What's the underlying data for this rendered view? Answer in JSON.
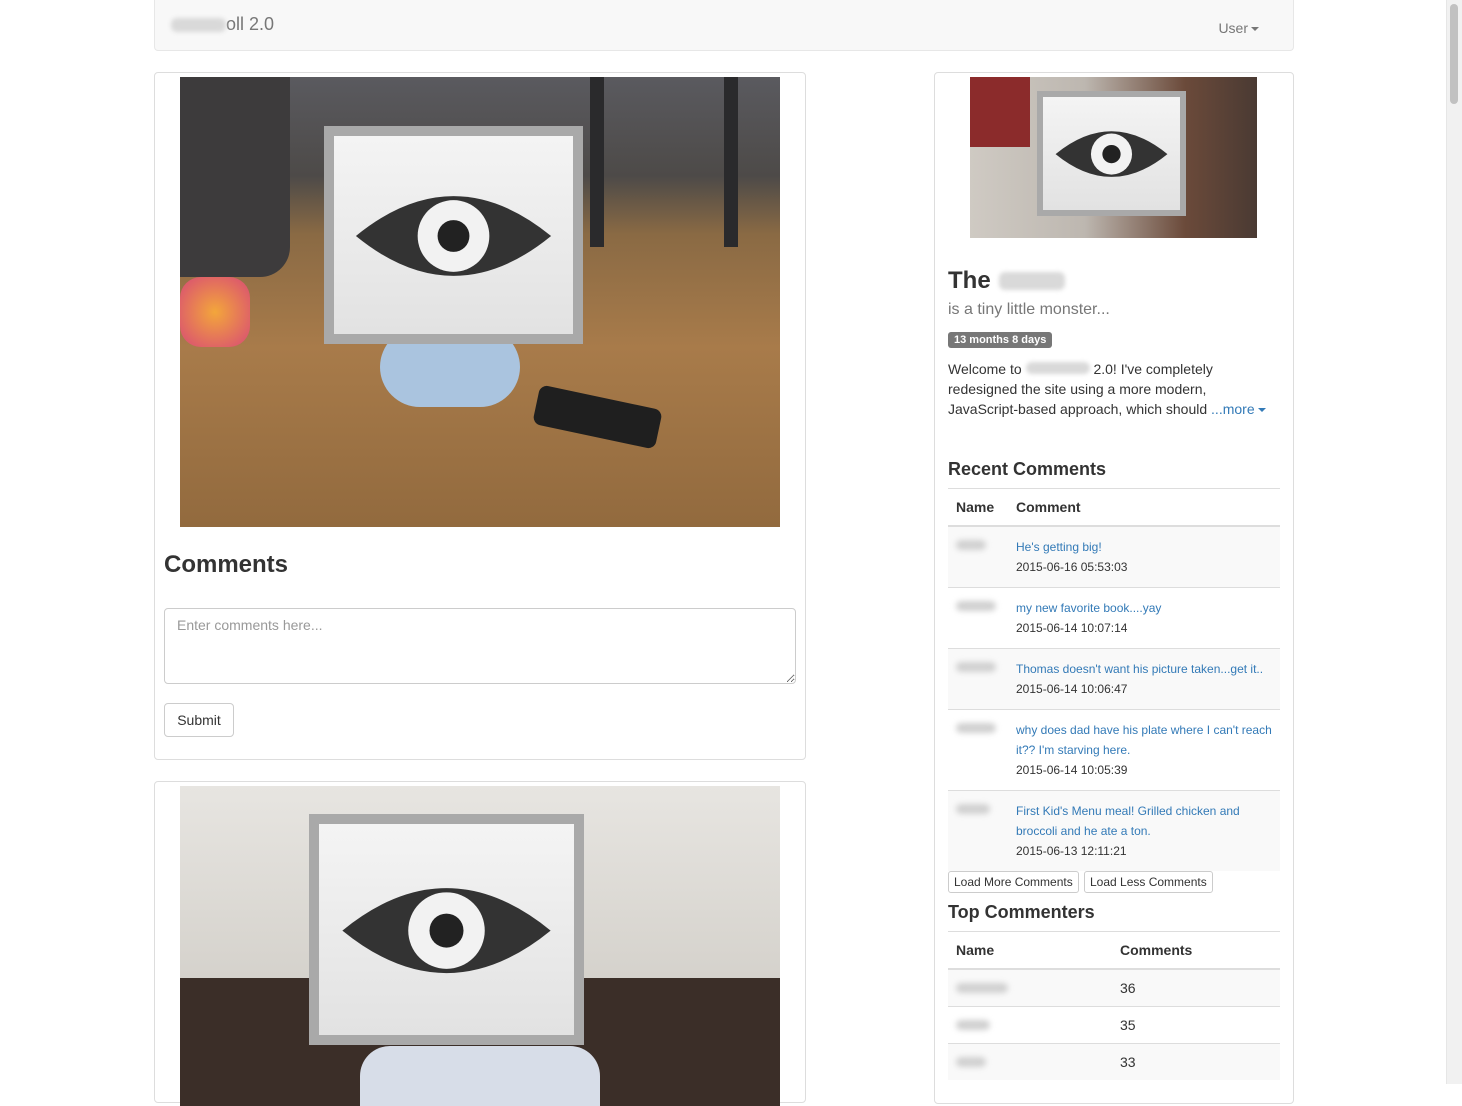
{
  "navbar": {
    "brand_suffix": "oll 2.0",
    "user_menu": "User"
  },
  "post1": {
    "comments_title": "Comments",
    "comment_placeholder": "Enter comments here...",
    "submit_label": "Submit"
  },
  "sidebar": {
    "title": "The",
    "subtitle": "is a tiny little monster...",
    "age_badge": "13 months 8 days",
    "intro_prefix": "Welcome to",
    "intro_rest": "2.0! I've completely redesigned the site using a more modern, JavaScript-based approach, which should",
    "more_link": "...more",
    "recent_comments": {
      "title": "Recent Comments",
      "headers": {
        "name": "Name",
        "comment": "Comment"
      },
      "rows": [
        {
          "comment": "He's getting big!",
          "date": "2015-06-16 05:53:03"
        },
        {
          "comment": "my new favorite book....yay",
          "date": "2015-06-14 10:07:14"
        },
        {
          "comment": "Thomas doesn't want his picture taken...get it..",
          "date": "2015-06-14 10:06:47"
        },
        {
          "comment": "why does dad have his plate where I can't reach it?? I'm starving here.",
          "date": "2015-06-14 10:05:39"
        },
        {
          "comment": "First Kid's Menu meal! Grilled chicken and broccoli and he ate a ton.",
          "date": "2015-06-13 12:11:21"
        }
      ],
      "load_more_label": "Load More Comments",
      "load_less_label": "Load Less Comments"
    },
    "top_commenters": {
      "title": "Top Commenters",
      "headers": {
        "name": "Name",
        "comments": "Comments"
      },
      "rows": [
        {
          "count": "36"
        },
        {
          "count": "35"
        },
        {
          "count": "33"
        }
      ]
    }
  },
  "colors": {
    "link": "#337ab7",
    "badge": "#777777",
    "navbar_bg": "#f8f8f8"
  },
  "icons": [
    "eye-icon",
    "caret-down-icon"
  ]
}
